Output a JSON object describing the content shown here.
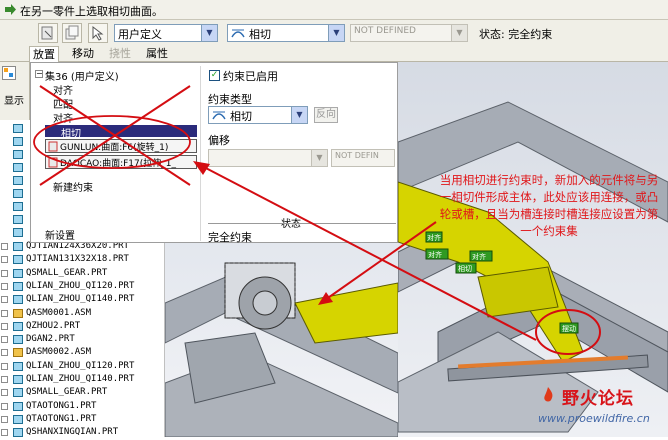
{
  "prompt": {
    "text": "在另一零件上选取相切曲面。"
  },
  "toolbar": {
    "user_defined_combo": "用户定义",
    "constraint_combo": "相切",
    "not_defined_combo": "NOT DEFINED",
    "status_label": "状态: 完全约束"
  },
  "tabs": [
    {
      "label": "放置",
      "state": "active"
    },
    {
      "label": "移动",
      "state": "normal"
    },
    {
      "label": "挠性",
      "state": "disabled"
    },
    {
      "label": "属性",
      "state": "normal"
    }
  ],
  "tree_stub": {
    "label": "显示"
  },
  "constraint_list": {
    "set_label": "集36 (用户定义)",
    "items": [
      "对齐",
      "匹配",
      "对齐"
    ],
    "selected_item": "相切",
    "ref1": "GUNLUN:曲面:F6(旋转_1)",
    "ref2": "DAOCAO:曲面:F17(拉伸_1_",
    "new_constraint": "新建约束",
    "new_set": "新设置"
  },
  "constraint_props": {
    "enabled_label": "约束已启用",
    "type_label": "约束类型",
    "type_value": "相切",
    "flip_button": "反向",
    "offset_label": "偏移",
    "offset_value": "NOT DEFIN",
    "status_heading": "状态",
    "status_value": "完全约束"
  },
  "tree": [
    "QJTIAN124X36X20.PRT",
    "QJTIAN131X32X18.PRT",
    "QSMALL_GEAR.PRT",
    "QLIAN_ZHOU_QI120.PRT",
    "QLIAN_ZHOU_QI140.PRT",
    "QASM0001.ASM",
    "QZHOU2.PRT",
    "DGAN2.PRT",
    "DASM0002.ASM",
    "QLIAN_ZHOU_QI120.PRT",
    "QLIAN_ZHOU_QI140.PRT",
    "QSMALL_GEAR.PRT",
    "QTAOTONG1.PRT",
    "QTAOTONG1.PRT",
    "QSHANXINGQIAN.PRT"
  ],
  "tree_asm_rows": [
    5,
    8
  ],
  "model_labels": [
    "对齐",
    "对齐",
    "相切",
    "对齐",
    "摆动"
  ],
  "annotation": "当用相切进行约束时，新加入的元件将与另一相切件形成主体，此处应该用连接，或凸轮或槽，且当为槽连接时槽连接应设置为第一个约束集",
  "watermark": {
    "title": "野火论坛",
    "url": "www.proewildfire.cn"
  },
  "colors": {
    "annotation": "#e0171a",
    "highlight": "#2b2b7b",
    "model_yellow": "#d6d400"
  }
}
